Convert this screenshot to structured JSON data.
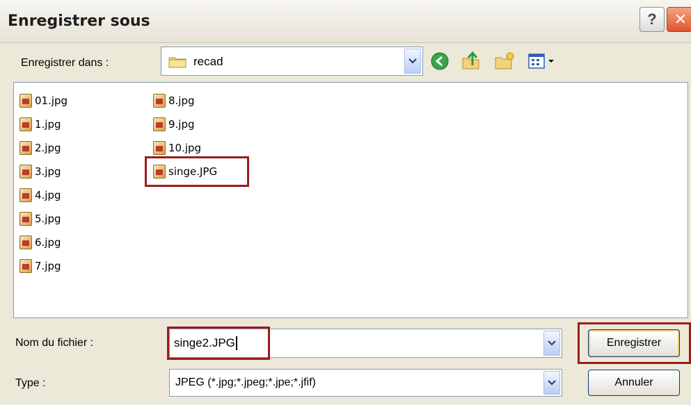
{
  "window": {
    "title": "Enregistrer sous",
    "help_label": "?",
    "close_label": "✕"
  },
  "save_in": {
    "label": "Enregistrer dans :",
    "folder": "recad"
  },
  "toolbar": {
    "back_icon": "back-arrow-icon",
    "up_icon": "up-folder-icon",
    "new_folder_icon": "new-folder-icon",
    "view_icon": "view-menu-icon"
  },
  "files": [
    "01.jpg",
    "1.jpg",
    "2.jpg",
    "3.jpg",
    "4.jpg",
    "5.jpg",
    "6.jpg",
    "7.jpg",
    "8.jpg",
    "9.jpg",
    "10.jpg",
    "singe.JPG"
  ],
  "filename": {
    "label": "Nom du fichier :",
    "value": "singe2.JPG"
  },
  "filetype": {
    "label": "Type :",
    "value": "JPEG (*.jpg;*.jpeg;*.jpe;*.jfif)"
  },
  "buttons": {
    "save": "Enregistrer",
    "cancel": "Annuler"
  },
  "colors": {
    "highlight": "#9B1B1B",
    "dialog_bg": "#ECE9D8"
  }
}
